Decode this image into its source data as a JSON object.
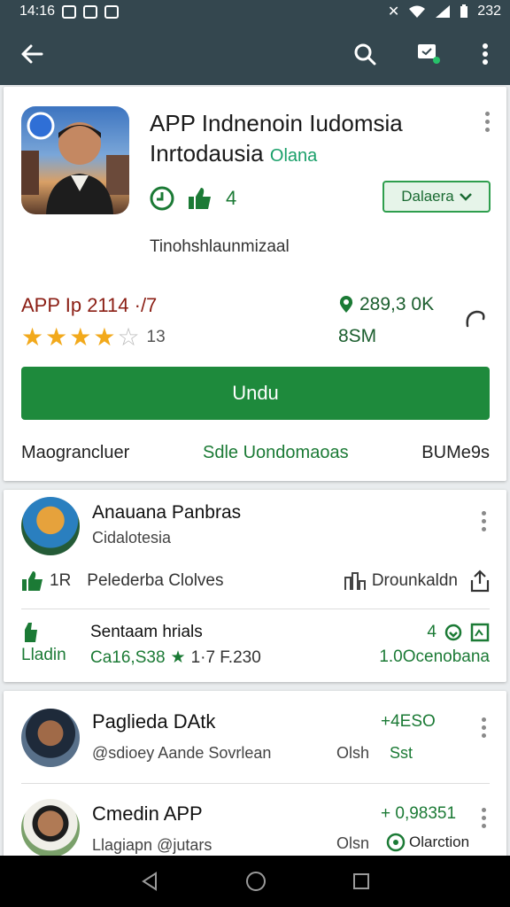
{
  "status": {
    "time": "14:16",
    "battery": "232"
  },
  "app": {
    "title_line1": "APP Indnenoin Iudomsia",
    "title_line2": "Inrtodausia",
    "title_sub": "Olana",
    "rating_badge": "4",
    "install_small": "Dalaera",
    "tagline": "Tinohshlaunmizaal",
    "price": "APP Ip 2114  ·/7",
    "stars_filled": 4,
    "stars_total": 5,
    "rating_count": "13",
    "downloads": "289,3 0K",
    "size": "8SM",
    "install_button": "Undu",
    "links": [
      "Maograncluer",
      "Sdle Uondomaoas",
      "BUMe9s"
    ]
  },
  "review_card": {
    "name": "Anauana Panbras",
    "sub": "Cidalotesia",
    "likes": "1R",
    "like_label": "Pelederba Clolves",
    "download_label": "Drounkaldn",
    "row2_left": "Lladin",
    "row2_title": "Sentaam hrials",
    "row2_value": "Ca16,S38",
    "row2_rating": "1·7 F.230",
    "row2_right_top": "4",
    "row2_right_bottom": "1.0Ocenobana"
  },
  "list": [
    {
      "name": "Paglieda DAtk",
      "sub": "@sdioey Aande Sovrlean",
      "value": "+4ESO",
      "meta": "Olsh",
      "tag": "Sst"
    },
    {
      "name": "Cmedin APP",
      "sub": "Llagiapn @jutars",
      "value": "+ 0,98351",
      "meta": "Olsn",
      "tag": "Olarction"
    }
  ],
  "colors": {
    "appbar": "#34474f",
    "accent_green": "#1e8a3c"
  }
}
